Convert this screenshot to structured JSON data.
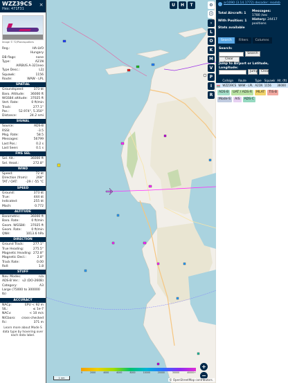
{
  "aircraft": {
    "callsign": "WZZ39CS",
    "hex_line": "Hex: 471F31",
    "close_icon": "×",
    "photo_credit": "Image © ?2/Planespotters",
    "details": [
      {
        "label": "Reg.:",
        "value": "HA-LVO"
      },
      {
        "label": "",
        "value": "Hungary"
      },
      {
        "label": "DB flags:",
        "value": "none"
      },
      {
        "label": "Type:",
        "value": "A21N"
      },
      {
        "label": "",
        "value": "AIRBUS A-321neo"
      },
      {
        "label": "Type Desc.:",
        "value": "L2J"
      },
      {
        "label": "Squawk:",
        "value": "1156"
      },
      {
        "label": "Route:",
        "value": "WAW - LPL"
      }
    ],
    "sections": [
      {
        "title": "SPATIAL",
        "rows": [
          {
            "label": "Groundspeed:",
            "value": "373 kt"
          },
          {
            "label": "Baro. Altitude:",
            "value": "36000 ft"
          },
          {
            "label": "WGS84 altitude:",
            "value": "37025 ft"
          },
          {
            "label": "Vert. Rate:",
            "value": "0 ft/min"
          },
          {
            "label": "Track:",
            "value": "277.1°"
          },
          {
            "label": "Pos.:",
            "value": "52.974°, 5.350°"
          },
          {
            "label": "Distance:",
            "value": "24.2 nmi"
          }
        ]
      },
      {
        "title": "SIGNAL",
        "rows": [
          {
            "label": "Source:",
            "value": "ADS-B"
          },
          {
            "label": "RSSI:",
            "value": "-3.5"
          },
          {
            "label": "Msg. Rate:",
            "value": "58.5"
          },
          {
            "label": "Messages:",
            "value": "56799"
          },
          {
            "label": "Last Pos.:",
            "value": "0.2 s"
          },
          {
            "label": "Last Seen:",
            "value": "0.1 s"
          }
        ]
      },
      {
        "title": "FMS SEL",
        "rows": [
          {
            "label": "Sel. Alt.:",
            "value": "36000 ft"
          },
          {
            "label": "Sel. Head.:",
            "value": "272.8°"
          }
        ]
      },
      {
        "title": "WIND",
        "rows": [
          {
            "label": "Speed:",
            "value": "72 kt"
          },
          {
            "label": "Direction (from):",
            "value": "268°"
          },
          {
            "label": "TAT / OAT:",
            "value": "-29 / -55 °C"
          }
        ]
      },
      {
        "title": "SPEED",
        "rows": [
          {
            "label": "Ground:",
            "value": "373 kt"
          },
          {
            "label": "True:",
            "value": "444 kt"
          },
          {
            "label": "Indicated:",
            "value": "255 kt"
          },
          {
            "label": "Mach:",
            "value": "0.772"
          }
        ]
      },
      {
        "title": "ALTITUDE",
        "rows": [
          {
            "label": "Barometric:",
            "value": "36000 ft"
          },
          {
            "label": "Baro. Rate:",
            "value": "0 ft/min"
          },
          {
            "label": "Geom. WGS84:",
            "value": "37025 ft"
          },
          {
            "label": "Geom. Rate:",
            "value": "0 ft/min"
          },
          {
            "label": "QNH:",
            "value": "1013.6 hPa"
          }
        ]
      },
      {
        "title": "DIRECTION",
        "rows": [
          {
            "label": "Ground Track:",
            "value": "277.1°"
          },
          {
            "label": "True Heading:",
            "value": "275.5°"
          },
          {
            "label": "Magnetic Heading:",
            "value": "272.8°"
          },
          {
            "label": "Magnetic Decl.:",
            "value": "2.8°"
          },
          {
            "label": "Track Rate:",
            "value": "0.00"
          },
          {
            "label": "Roll:",
            "value": "1.8"
          }
        ]
      },
      {
        "title": "STUFF",
        "rows": [
          {
            "label": "Nav. Modes:",
            "value": "n/a"
          },
          {
            "label": "ADS-B Ver.:",
            "value": "v2 (DO-260B)"
          },
          {
            "label": "Category:",
            "value": "A3"
          },
          {
            "label": "Large (75000 to 300000 lb)",
            "value": ""
          }
        ]
      },
      {
        "title": "ACCURACY",
        "rows": [
          {
            "label": "NACp:",
            "value": "EPU < 92 m"
          },
          {
            "label": "SIL:",
            "value": "≤ 1e-7"
          },
          {
            "label": "NACv:",
            "value": "< 10 m/s"
          },
          {
            "label": "NICbaro:",
            "value": "cross-checked"
          },
          {
            "label": "Rc:",
            "value": "371 m"
          }
        ]
      }
    ],
    "footnote": "Learn more about Mode S data type by hovering over each data label."
  },
  "map": {
    "top_buttons": [
      "U",
      "H",
      "T"
    ],
    "zoom_in": "+",
    "zoom_out": "−",
    "scale_label": "1 nm",
    "altitude_ticks": [
      "0",
      "2000",
      "4000",
      "6000",
      "8000",
      "10000",
      "20000",
      "30000",
      "40000+"
    ],
    "attribution": "© OpenStreetMap contributors.",
    "colors": {
      "water": "#aad3df",
      "land": "#f2efe9",
      "farmland": "#ece8d8",
      "forest": "#c8dbb0",
      "selected_plane": "#ff2aff"
    }
  },
  "toolbar": {
    "buttons": [
      "L",
      "O",
      "K",
      "M",
      "V",
      "P",
      "I",
      "R"
    ]
  },
  "summary": {
    "version_text": "ar1090 (3.14.1772) decoder: readsb",
    "total_aircraft_label": "Total Aircraft:",
    "total_aircraft_value": "1",
    "with_position_label": "With Position:",
    "with_position_value": "1",
    "messages_label": "Messages:",
    "messages_value": "1780 /sec",
    "history_label": "History:",
    "history_value": "24417 positions",
    "stats_label": "Stats available"
  },
  "tabs": [
    "Search",
    "Filters",
    "Columns"
  ],
  "search": {
    "label": "Search:",
    "search_button": "Search",
    "clear_button": "Clear Search",
    "jump_label": "Jump to Airport or Latitude, Longitude:",
    "jump_button": "Jump",
    "jump_clear_button": "Clear"
  },
  "table": {
    "headers": [
      "",
      "Callsign",
      "Route",
      "Type",
      "Squawk",
      "Alt. (ft)"
    ],
    "rows": [
      {
        "callsign": "WZZ39CS",
        "route": "WAW - LPL",
        "type": "A21N",
        "squawk": "1156",
        "alt": "36000"
      }
    ]
  },
  "legend": [
    "ADS-B",
    "UAT / ADS-R",
    "MLAT",
    "TIS-B",
    "Mode-S",
    "AIS",
    "ADS-C"
  ]
}
